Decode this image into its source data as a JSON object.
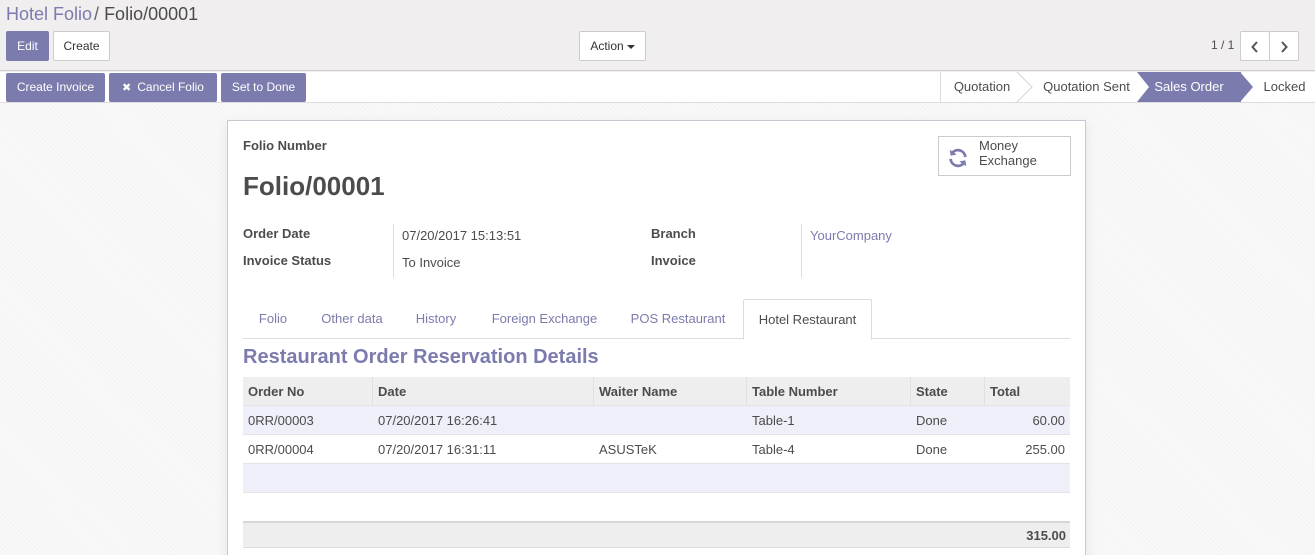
{
  "breadcrumb": {
    "parent": "Hotel Folio",
    "separator": "/",
    "current": "Folio/00001"
  },
  "toolbar": {
    "edit_label": "Edit",
    "create_label": "Create",
    "action_label": "Action"
  },
  "pager": {
    "value": "1 / 1"
  },
  "statusbar": {
    "buttons": {
      "create_invoice": "Create Invoice",
      "cancel_folio": "Cancel Folio",
      "set_to_done": "Set to Done"
    },
    "stages": [
      "Quotation",
      "Quotation Sent",
      "Sales Order",
      "Locked"
    ],
    "current_stage": "Sales Order"
  },
  "form": {
    "folio_number_label": "Folio Number",
    "name": "Folio/00001",
    "order_date_label": "Order Date",
    "order_date": "07/20/2017 15:13:51",
    "invoice_status_label": "Invoice Status",
    "invoice_status": "To Invoice",
    "branch_label": "Branch",
    "branch": "YourCompany",
    "invoice_label": "Invoice",
    "money_exchange_line1": "Money",
    "money_exchange_line2": "Exchange"
  },
  "tabs": [
    "Folio",
    "Other data",
    "History",
    "Foreign Exchange",
    "POS Restaurant",
    "Hotel Restaurant"
  ],
  "active_tab": "Hotel Restaurant",
  "section_title": "Restaurant Order Reservation Details",
  "table": {
    "columns": [
      "Order No",
      "Date",
      "Waiter Name",
      "Table Number",
      "State",
      "Total"
    ],
    "rows": [
      [
        "0RR/00003",
        "07/20/2017 16:26:41",
        "",
        "Table-1",
        "Done",
        "60.00"
      ],
      [
        "0RR/00004",
        "07/20/2017 16:31:11",
        "ASUSTeK",
        "Table-4",
        "Done",
        "255.00"
      ]
    ],
    "total": "315.00"
  },
  "colors": {
    "accent": "#7c7bad",
    "background": "#f0eeee",
    "text": "#4c4c4c"
  }
}
